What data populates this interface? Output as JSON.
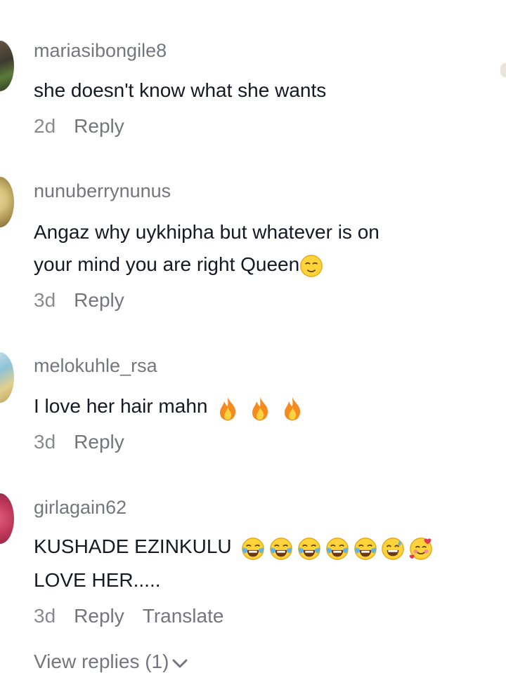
{
  "comments": [
    {
      "username": "mariasibongile8",
      "text": "she doesn't know what she wants",
      "time": "2d",
      "reply_label": "Reply"
    },
    {
      "username": "nunuberrynunus",
      "text_line1": "Angaz why uykhipha but whatever is on",
      "text_line2": "your mind you are right Queen",
      "time": "3d",
      "reply_label": "Reply"
    },
    {
      "username": "melokuhle_rsa",
      "text": "I love her hair mahn",
      "time": "3d",
      "reply_label": "Reply"
    },
    {
      "username": "girlagain62",
      "text_line1": "KUSHADE EZINKULU",
      "text_line2": "LOVE HER.....",
      "time": "3d",
      "reply_label": "Reply",
      "translate_label": "Translate",
      "view_replies_label": "View replies (1)"
    }
  ],
  "icons": {
    "relieved_face": "relieved-face-emoji",
    "fire": "fire-emoji",
    "laughing_tears": "face-with-tears-of-joy-emoji",
    "grinning_sweat": "grinning-face-with-sweat-emoji",
    "smiling_hearts": "smiling-face-with-hearts-emoji",
    "chevron": "chevron-down-icon"
  },
  "colors": {
    "username": "#75767d",
    "text": "#161823",
    "meta": "#8a8b91"
  }
}
